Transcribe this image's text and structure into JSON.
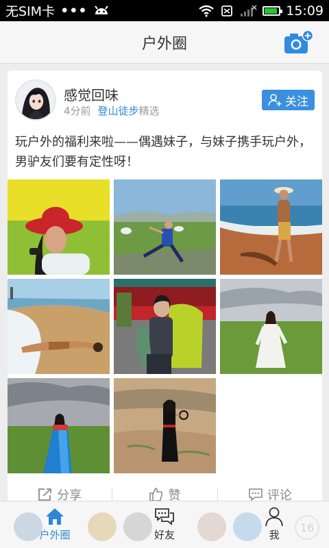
{
  "status_bar": {
    "carrier": "无SIM卡",
    "dots": "•••",
    "time": "15:09",
    "battery_level_percent": 90,
    "battery_color": "#28c43a"
  },
  "header": {
    "title": "户外圈",
    "camera_icon": "camera-add-icon",
    "accent": "#2c87d6"
  },
  "post": {
    "username": "感觉回味",
    "time_ago": "4分前",
    "tag": "登山徒步",
    "label": "精选",
    "follow_label": "关注",
    "text": "玩户外的福利来啦——偶遇妹子，与妹子携手玩户外，男驴友们要有定性呀！",
    "photos": [
      "photo-red-hat-phone",
      "photo-grassland-jump",
      "photo-beach-hat",
      "photo-lying-on-beach",
      "photo-green-backpack",
      "photo-white-dress-grassland",
      "photo-blue-dress",
      "photo-black-dress-hills"
    ],
    "actions": {
      "share": "分享",
      "like": "赞",
      "comment": "评论"
    }
  },
  "bottom_nav": {
    "items": [
      {
        "label": "户外圈",
        "icon": "home-icon",
        "active": true
      },
      {
        "label": "好友",
        "icon": "chat-bubbles-icon",
        "active": false
      },
      {
        "label": "我",
        "icon": "person-icon",
        "active": false
      }
    ],
    "badge_count": "16"
  }
}
